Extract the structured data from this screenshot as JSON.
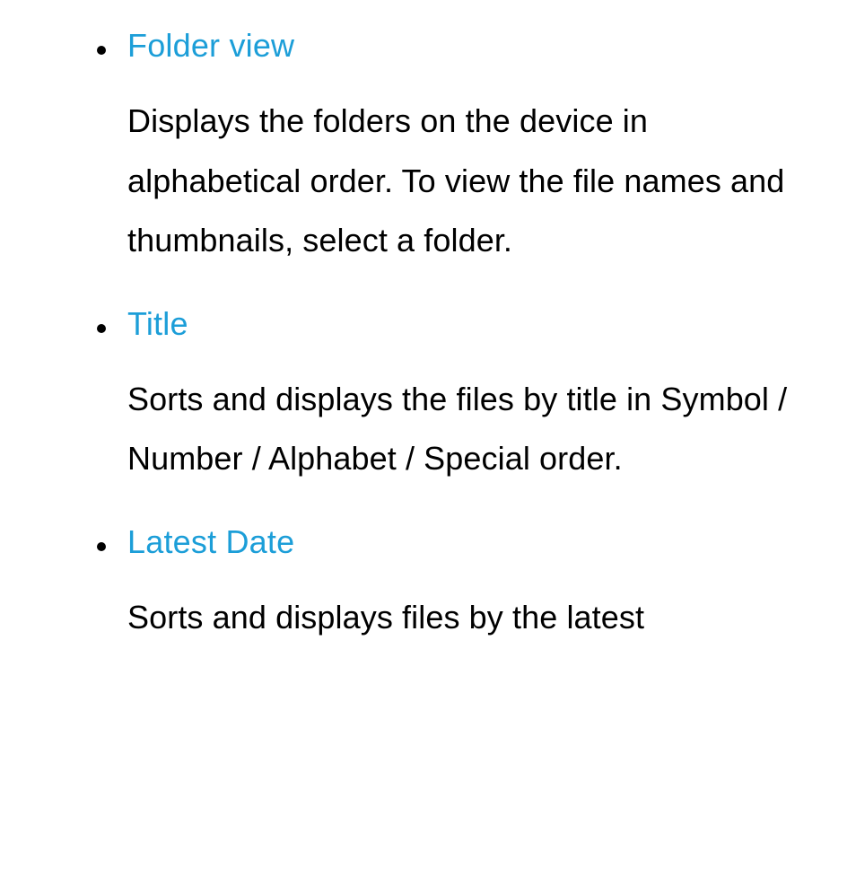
{
  "list": {
    "items": [
      {
        "term": "Folder view",
        "description": "Displays the folders on the device in alphabetical order. To view the file names and thumbnails, select a folder."
      },
      {
        "term": "Title",
        "description": "Sorts and displays the files by title in Symbol / Number / Alphabet / Special order."
      },
      {
        "term": "Latest Date",
        "description": "Sorts and displays files by the latest"
      }
    ]
  }
}
